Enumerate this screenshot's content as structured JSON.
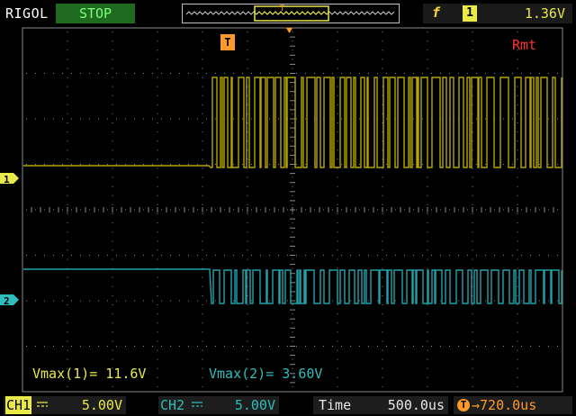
{
  "header": {
    "brand": "RIGOL",
    "run_state": "STOP",
    "trigger": {
      "slope_icon": "rising-edge-icon",
      "source": "1",
      "level": "1.36V"
    }
  },
  "status": {
    "remote": "Rmt"
  },
  "trigger_position_marker": "T",
  "channel_markers": {
    "ch1": "1",
    "ch2": "2"
  },
  "measurements": {
    "ch1": "Vmax(1)= 11.6V",
    "ch2": "Vmax(2)= 3.60V"
  },
  "footer": {
    "ch1": {
      "label": "CH1",
      "coupling": "DC",
      "scale": "5.00V"
    },
    "ch2": {
      "label": "CH2",
      "coupling": "DC",
      "scale": "5.00V"
    },
    "time": {
      "label": "Time",
      "value": "500.0us"
    },
    "trigger_offset": {
      "icon": "trigger-offset-icon",
      "value": "→720.0us"
    }
  },
  "colors": {
    "ch1": "#b5a500",
    "ch2": "#1fa3a8",
    "grid": "#8a8a8a",
    "trigger": "#ff9a2a",
    "remote": "#ff3030"
  },
  "waveforms": {
    "ch1": {
      "trace_shape": "digital burst",
      "low_level": "flat",
      "activity": "dense pulses after trigger"
    },
    "ch2": {
      "trace_shape": "digital burst",
      "low_level": "flat",
      "activity": "dense pulses after trigger"
    }
  }
}
